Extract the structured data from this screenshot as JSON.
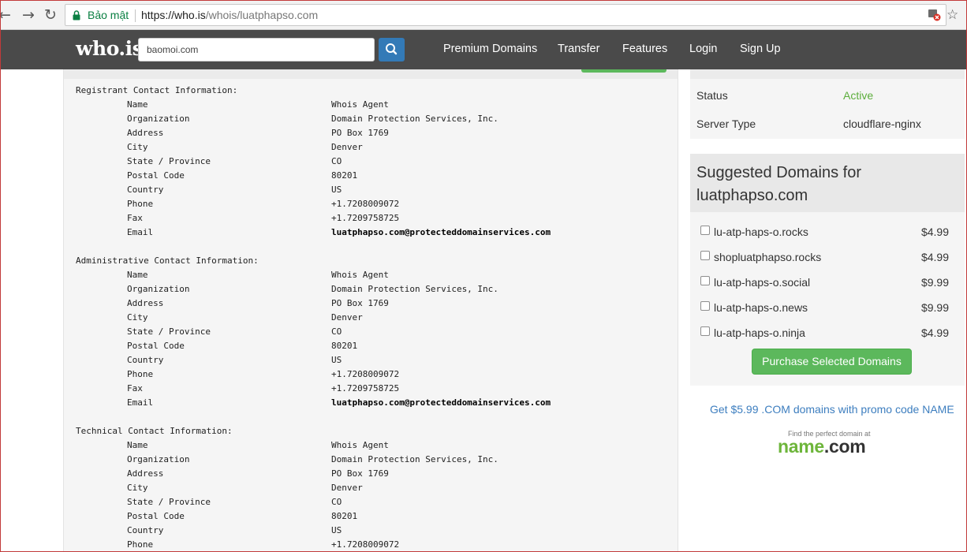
{
  "browser": {
    "secure_label": "Bảo mật",
    "url_host": "https://who.is",
    "url_path": "/whois/luatphapso.com",
    "icons": [
      "back-arrow-icon",
      "forward-arrow-icon",
      "reload-icon",
      "lock-icon",
      "blocked-popup-icon",
      "bookmark-star-icon"
    ]
  },
  "header": {
    "logo": "who.is",
    "search_value": "baomoi.com",
    "nav": [
      "Premium Domains",
      "Transfer",
      "Features",
      "Login",
      "Sign Up"
    ]
  },
  "whois": {
    "registrant": {
      "title": "Registrant Contact Information:",
      "fields": [
        {
          "k": "Name",
          "v": "Whois Agent"
        },
        {
          "k": "Organization",
          "v": "Domain Protection Services, Inc."
        },
        {
          "k": "Address",
          "v": "PO Box 1769"
        },
        {
          "k": "City",
          "v": "Denver"
        },
        {
          "k": "State / Province",
          "v": "CO"
        },
        {
          "k": "Postal Code",
          "v": "80201"
        },
        {
          "k": "Country",
          "v": "US"
        },
        {
          "k": "Phone",
          "v": "+1.7208009072"
        },
        {
          "k": "Fax",
          "v": "+1.7209758725"
        },
        {
          "k": "Email",
          "v": "luatphapso.com@protecteddomainservices.com"
        }
      ]
    },
    "administrative": {
      "title": "Administrative Contact Information:",
      "fields": [
        {
          "k": "Name",
          "v": "Whois Agent"
        },
        {
          "k": "Organization",
          "v": "Domain Protection Services, Inc."
        },
        {
          "k": "Address",
          "v": "PO Box 1769"
        },
        {
          "k": "City",
          "v": "Denver"
        },
        {
          "k": "State / Province",
          "v": "CO"
        },
        {
          "k": "Postal Code",
          "v": "80201"
        },
        {
          "k": "Country",
          "v": "US"
        },
        {
          "k": "Phone",
          "v": "+1.7208009072"
        },
        {
          "k": "Fax",
          "v": "+1.7209758725"
        },
        {
          "k": "Email",
          "v": "luatphapso.com@protecteddomainservices.com"
        }
      ]
    },
    "technical": {
      "title": "Technical Contact Information:",
      "fields": [
        {
          "k": "Name",
          "v": "Whois Agent"
        },
        {
          "k": "Organization",
          "v": "Domain Protection Services, Inc."
        },
        {
          "k": "Address",
          "v": "PO Box 1769"
        },
        {
          "k": "City",
          "v": "Denver"
        },
        {
          "k": "State / Province",
          "v": "CO"
        },
        {
          "k": "Postal Code",
          "v": "80201"
        },
        {
          "k": "Country",
          "v": "US"
        },
        {
          "k": "Phone",
          "v": "+1.7208009072"
        }
      ]
    }
  },
  "site_info": {
    "status_label": "Status",
    "status_value": "Active",
    "server_label": "Server Type",
    "server_value": "cloudflare-nginx"
  },
  "suggested": {
    "title_line1": "Suggested Domains for",
    "title_line2": "luatphapso.com",
    "items": [
      {
        "domain": "lu-atp-haps-o.rocks",
        "price": "$4.99"
      },
      {
        "domain": "shopluatphapso.rocks",
        "price": "$4.99"
      },
      {
        "domain": "lu-atp-haps-o.social",
        "price": "$9.99"
      },
      {
        "domain": "lu-atp-haps-o.news",
        "price": "$9.99"
      },
      {
        "domain": "lu-atp-haps-o.ninja",
        "price": "$4.99"
      }
    ],
    "purchase_label": "Purchase Selected Domains"
  },
  "promo": {
    "text": "Get $5.99 .COM domains with promo code NAME",
    "tagline": "Find the perfect domain at",
    "logo_name": "name",
    "logo_tld": ".com"
  },
  "colors": {
    "header_bg": "#4a4a4a",
    "search_button": "#337ab7",
    "accent_green": "#5cb85c",
    "status_active": "#5cae3c",
    "promo_link": "#3d7ebf"
  }
}
